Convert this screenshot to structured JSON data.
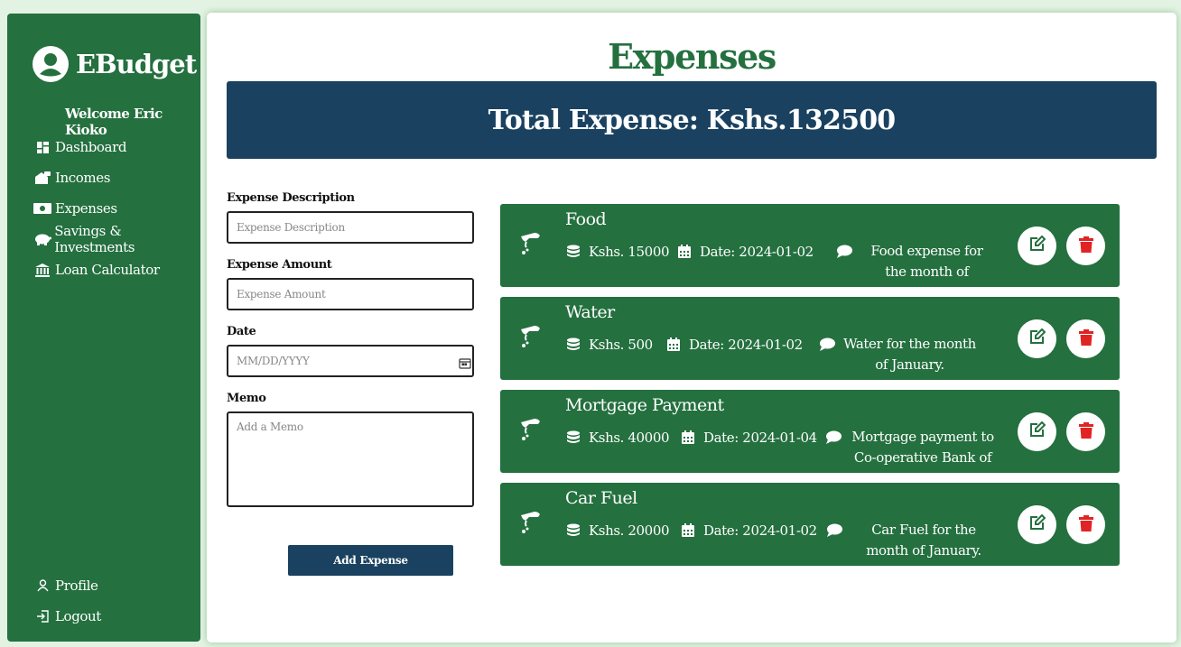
{
  "app": {
    "brand": "EBudget",
    "welcome": "Welcome Eric Kioko"
  },
  "sidebar": {
    "items": [
      {
        "label": "Dashboard",
        "icon": "dashboard-icon"
      },
      {
        "label": "Incomes",
        "icon": "income-icon"
      },
      {
        "label": "Expenses",
        "icon": "money-icon"
      },
      {
        "label": "Savings & Investments",
        "icon": "piggy-bank-icon"
      },
      {
        "label": "Loan Calculator",
        "icon": "bank-icon"
      }
    ],
    "bottom": [
      {
        "label": "Profile",
        "icon": "user-icon"
      },
      {
        "label": "Logout",
        "icon": "logout-icon"
      }
    ]
  },
  "page": {
    "title": "Expenses",
    "total": "Total Expense: Kshs.132500"
  },
  "form": {
    "description_label": "Expense Description",
    "description_placeholder": "Expense Description",
    "amount_label": "Expense Amount",
    "amount_placeholder": "Expense Amount",
    "date_label": "Date",
    "date_placeholder": "MM/DD/YYYY",
    "memo_label": "Memo",
    "memo_placeholder": "Add a Memo",
    "submit_label": "Add Expense"
  },
  "expenses": [
    {
      "name": "Food",
      "amount": "Kshs. 15000",
      "date": "Date: 2024-01-02",
      "memo": "Food expense for the month of January."
    },
    {
      "name": "Water",
      "amount": "Kshs. 500",
      "date": "Date: 2024-01-02",
      "memo": "Water for the month of January."
    },
    {
      "name": "Mortgage Payment",
      "amount": "Kshs. 40000",
      "date": "Date: 2024-01-04",
      "memo": "Mortgage payment to Co-operative Bank of Kenya."
    },
    {
      "name": "Car Fuel",
      "amount": "Kshs. 20000",
      "date": "Date: 2024-01-02",
      "memo": "Car Fuel for the month of January."
    }
  ],
  "colors": {
    "sidebar": "#24703f",
    "banner": "#1a4260",
    "delete": "#e02424",
    "background": "#e3f3e3"
  }
}
